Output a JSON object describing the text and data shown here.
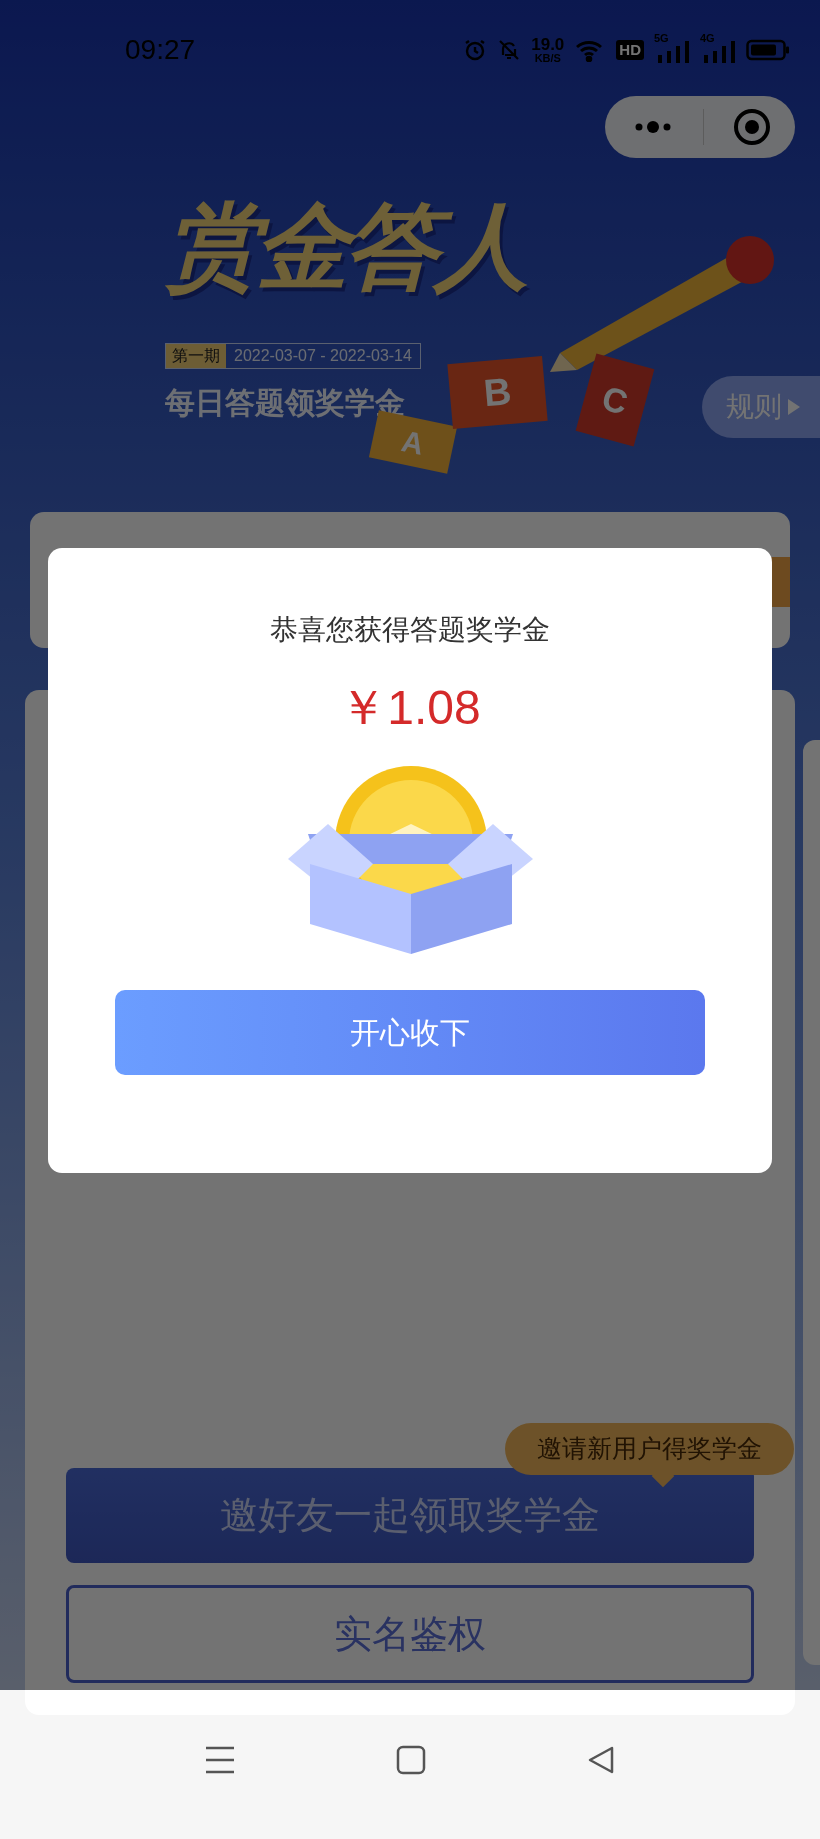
{
  "status_bar": {
    "time": "09:27",
    "network_speed": "19.0",
    "network_speed_unit": "KB/S",
    "hd_badge": "HD",
    "signal_labels": [
      "5G",
      "4G"
    ]
  },
  "banner": {
    "title": "赏金答人",
    "period_label": "第一期",
    "date_range": "2022-03-07 - 2022-03-14",
    "subtitle": "每日答题领奖学金",
    "answer_cards": [
      "A",
      "B",
      "C"
    ],
    "rules_button": "规则"
  },
  "modal": {
    "title": "恭喜您获得答题奖学金",
    "amount": "￥1.08",
    "confirm_button": "开心收下"
  },
  "invite_tooltip": "邀请新用户得奖学金",
  "buttons": [
    {
      "kind": "filled",
      "label": "邀好友一起领取奖学金"
    },
    {
      "kind": "outline",
      "label": "实名鉴权"
    }
  ]
}
